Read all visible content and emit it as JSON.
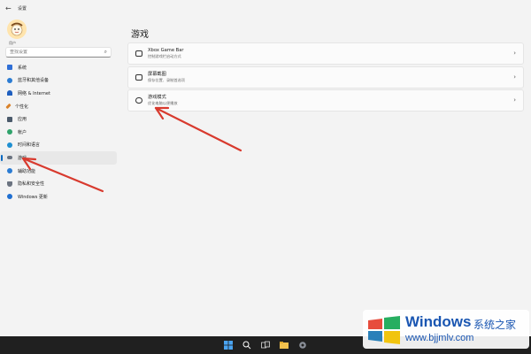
{
  "window": {
    "title": "设置",
    "back_icon": "back-arrow-icon"
  },
  "account": {
    "name": "用户"
  },
  "search": {
    "placeholder": "查找设置",
    "icon": "search-icon"
  },
  "sidebar": {
    "items": [
      {
        "label": "系统",
        "icon": "monitor-icon",
        "color": "#2f6fd6",
        "active": false
      },
      {
        "label": "蓝牙和其他设备",
        "icon": "bluetooth-icon",
        "color": "#2b7cd3",
        "active": false
      },
      {
        "label": "网络 & Internet",
        "icon": "wifi-icon",
        "color": "#1f5fbf",
        "active": false
      },
      {
        "label": "个性化",
        "icon": "brush-icon",
        "color": "#d9822b",
        "active": false
      },
      {
        "label": "应用",
        "icon": "apps-icon",
        "color": "#4b5a6b",
        "active": false
      },
      {
        "label": "帐户",
        "icon": "person-icon",
        "color": "#2fa36b",
        "active": false
      },
      {
        "label": "时间和语言",
        "icon": "globe-clock-icon",
        "color": "#1f8fd1",
        "active": false
      },
      {
        "label": "游戏",
        "icon": "gamepad-icon",
        "color": "#6b7380",
        "active": true
      },
      {
        "label": "辅助功能",
        "icon": "accessibility-icon",
        "color": "#2b7cd3",
        "active": false
      },
      {
        "label": "隐私和安全性",
        "icon": "shield-icon",
        "color": "#6b7380",
        "active": false
      },
      {
        "label": "Windows 更新",
        "icon": "update-icon",
        "color": "#1f6fd1",
        "active": false
      }
    ]
  },
  "main": {
    "title": "游戏",
    "cards": [
      {
        "title": "Xbox Game Bar",
        "subtitle": "控制游戏栏启动方式",
        "icon": "xbox-controller-icon"
      },
      {
        "title": "屏幕截图",
        "subtitle": "保存位置、录制首选项",
        "icon": "capture-icon"
      },
      {
        "title": "游戏模式",
        "subtitle": "优化电脑以便播放",
        "icon": "game-mode-icon"
      }
    ]
  },
  "taskbar": {
    "icons": [
      "start-icon",
      "search-icon",
      "taskview-icon",
      "explorer-icon",
      "settings-icon"
    ]
  },
  "watermark": {
    "brand": "Windows",
    "cn": "系统之家",
    "url": "www.bjjmlv.com"
  },
  "annotation": {
    "color": "#d83a2e"
  }
}
